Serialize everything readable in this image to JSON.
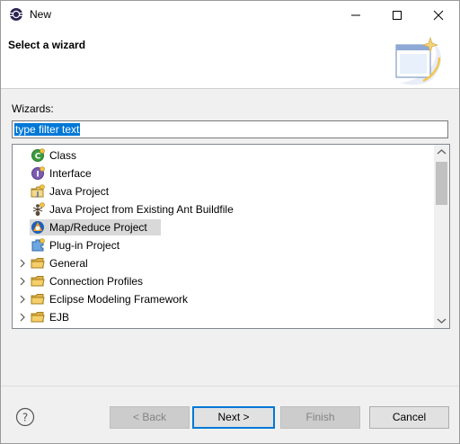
{
  "window": {
    "title": "New",
    "header_title": "Select a wizard",
    "icons": {
      "app": "eclipse-icon",
      "banner": "new-wizard-banner-icon"
    }
  },
  "wizards_label": "Wizards:",
  "filter": {
    "value": "type filter text",
    "selected": true
  },
  "tree": {
    "items": [
      {
        "label": "Class",
        "icon": "class-icon",
        "expandable": false,
        "selected": false
      },
      {
        "label": "Interface",
        "icon": "interface-icon",
        "expandable": false,
        "selected": false
      },
      {
        "label": "Java Project",
        "icon": "java-project-icon",
        "expandable": false,
        "selected": false
      },
      {
        "label": "Java Project from Existing Ant Buildfile",
        "icon": "ant-icon",
        "expandable": false,
        "selected": false
      },
      {
        "label": "Map/Reduce Project",
        "icon": "mapreduce-icon",
        "expandable": false,
        "selected": true
      },
      {
        "label": "Plug-in Project",
        "icon": "plugin-icon",
        "expandable": false,
        "selected": false
      },
      {
        "label": "General",
        "icon": "folder-icon",
        "expandable": true,
        "selected": false
      },
      {
        "label": "Connection Profiles",
        "icon": "folder-icon",
        "expandable": true,
        "selected": false
      },
      {
        "label": "Eclipse Modeling Framework",
        "icon": "folder-icon",
        "expandable": true,
        "selected": false
      },
      {
        "label": "EJB",
        "icon": "folder-icon",
        "expandable": true,
        "selected": false
      }
    ]
  },
  "buttons": {
    "back": "< Back",
    "next": "Next >",
    "finish": "Finish",
    "cancel": "Cancel"
  },
  "colors": {
    "selection": "#0078d7",
    "default_button_border": "#0078d7",
    "disabled_text": "#838383"
  }
}
